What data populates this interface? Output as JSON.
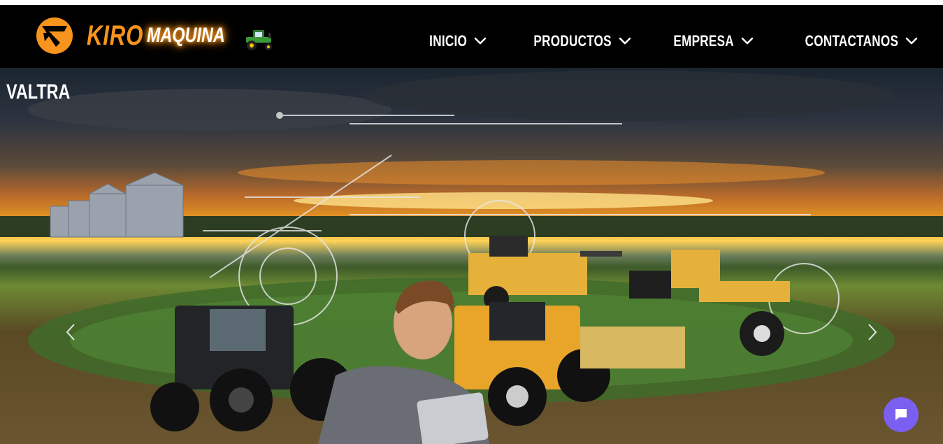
{
  "brand": {
    "name_primary": "KIRO",
    "name_secondary": "MAQUINA",
    "accent_color": "#f7941d",
    "logo_icon": "kiro-logo-icon",
    "decor_icon": "tractor-icon"
  },
  "nav": {
    "items": [
      {
        "label": "INICIO",
        "icon": "chevron-down-icon"
      },
      {
        "label": "PRODUCTOS",
        "icon": "chevron-down-icon"
      },
      {
        "label": "EMPRESA",
        "icon": "chevron-down-icon"
      },
      {
        "label": "CONTACTANOS",
        "icon": "chevron-down-icon"
      }
    ]
  },
  "hero": {
    "slide_title": "VALTRA",
    "prev_icon": "chevron-left-icon",
    "next_icon": "chevron-right-icon"
  },
  "chat": {
    "icon": "chat-bubble-icon",
    "color": "#7b5ff0"
  }
}
